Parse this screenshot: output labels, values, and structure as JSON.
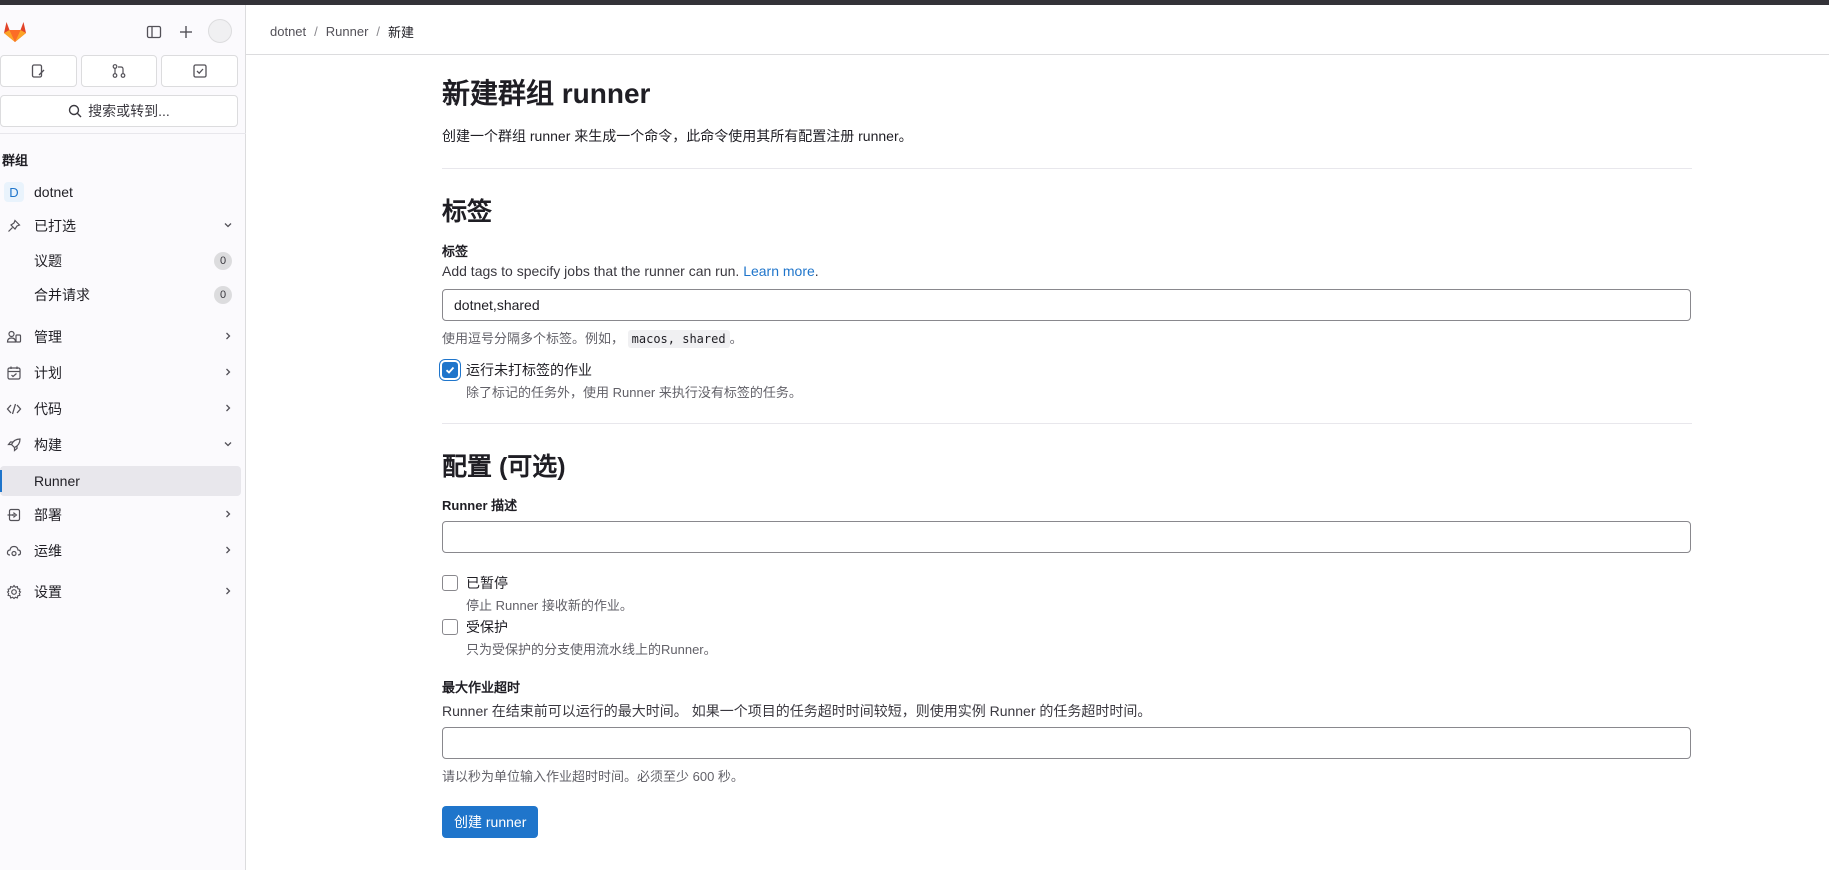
{
  "sidebar": {
    "search_label": "搜索或转到...",
    "section_title": "群组",
    "group": {
      "initial": "D",
      "name": "dotnet"
    },
    "pinned": {
      "label": "已打选",
      "items": [
        {
          "label": "议题",
          "count": "0"
        },
        {
          "label": "合并请求",
          "count": "0"
        }
      ]
    },
    "nav": [
      {
        "label": "管理"
      },
      {
        "label": "计划"
      },
      {
        "label": "代码"
      },
      {
        "label": "构建"
      },
      {
        "label": "Runner"
      },
      {
        "label": "部署"
      },
      {
        "label": "运维"
      },
      {
        "label": "设置"
      }
    ]
  },
  "breadcrumb": [
    "dotnet",
    "Runner",
    "新建"
  ],
  "page": {
    "title": "新建群组 runner",
    "description": "创建一个群组 runner 来生成一个命令，此命令使用其所有配置注册 runner。"
  },
  "tags_section": {
    "heading": "标签",
    "label": "标签",
    "help": "Add tags to specify jobs that the runner can run.",
    "learn_more": "Learn more",
    "period": ".",
    "value": "dotnet,shared",
    "hint_prefix": "使用逗号分隔多个标签。例如，",
    "hint_code": "macos, shared",
    "hint_suffix": "。",
    "untagged": {
      "label": "运行未打标签的作业",
      "help": "除了标记的任务外，使用 Runner 来执行没有标签的任务。",
      "checked": true
    }
  },
  "config_section": {
    "heading": "配置 (可选)",
    "description_label": "Runner 描述",
    "description_value": "",
    "paused": {
      "label": "已暂停",
      "help": "停止 Runner 接收新的作业。",
      "checked": false
    },
    "protected": {
      "label": "受保护",
      "help": "只为受保护的分支使用流水线上的Runner。",
      "checked": false
    },
    "timeout_label": "最大作业超时",
    "timeout_help": "Runner 在结束前可以运行的最大时间。 如果一个项目的任务超时时间较短，则使用实例 Runner 的任务超时时间。",
    "timeout_value": "",
    "timeout_hint": "请以秒为单位输入作业超时时间。必须至少 600 秒。"
  },
  "submit_label": "创建 runner",
  "colors": {
    "primary": "#1f75cb",
    "brand_orange": "#e24329"
  }
}
